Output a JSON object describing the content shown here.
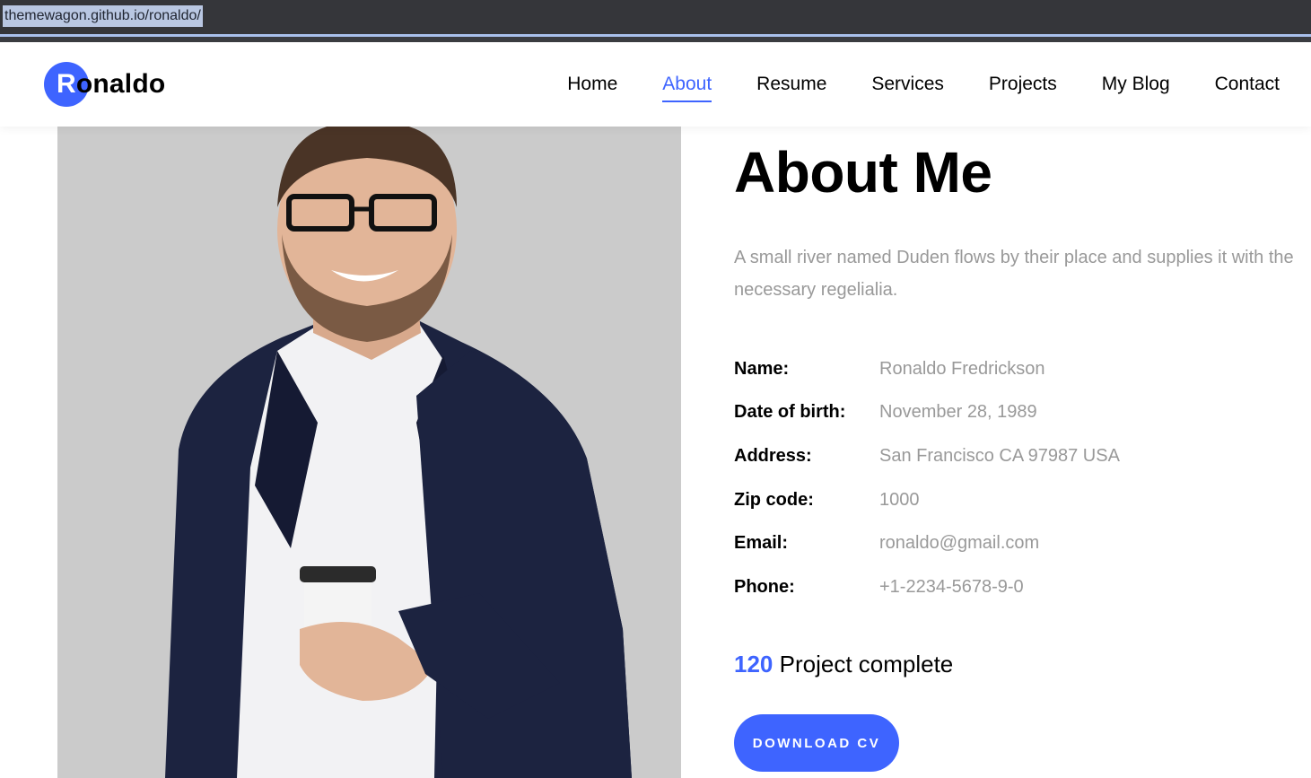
{
  "browser": {
    "url": "themewagon.github.io/ronaldo/"
  },
  "brand": {
    "first_letter": "R",
    "rest": "onaldo",
    "accent": "#3e64ff"
  },
  "nav": {
    "items": [
      {
        "label": "Home"
      },
      {
        "label": "About",
        "active": true
      },
      {
        "label": "Resume"
      },
      {
        "label": "Services"
      },
      {
        "label": "Projects"
      },
      {
        "label": "My Blog"
      },
      {
        "label": "Contact"
      }
    ]
  },
  "about": {
    "title": "About Me",
    "description": "A small river named Duden flows by their place and supplies it with the necessary regelialia.",
    "info": [
      {
        "label": "Name:",
        "value": "Ronaldo Fredrickson"
      },
      {
        "label": "Date of birth:",
        "value": "November 28, 1989"
      },
      {
        "label": "Address:",
        "value": "San Francisco CA 97987 USA"
      },
      {
        "label": "Zip code:",
        "value": "1000"
      },
      {
        "label": "Email:",
        "value": "ronaldo@gmail.com"
      },
      {
        "label": "Phone:",
        "value": "+1-2234-5678-9-0"
      }
    ],
    "projects_count": "120",
    "projects_label": "Project complete",
    "download_label": "DOWNLOAD CV"
  }
}
